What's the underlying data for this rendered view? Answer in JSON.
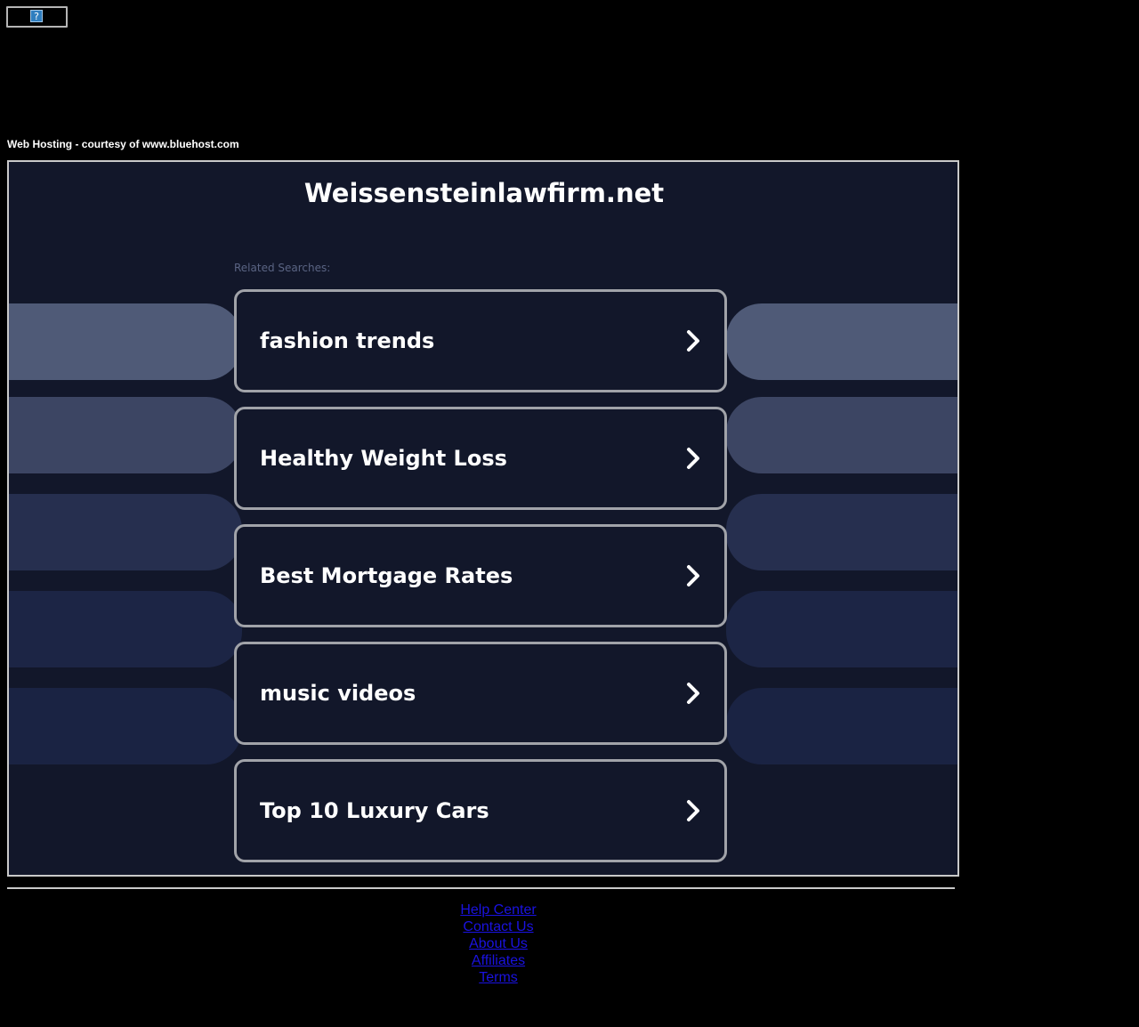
{
  "header": {
    "broken_image_icon": "question-mark-icon",
    "broken_image_glyph": "?",
    "courtesy_text": "Web Hosting - courtesy of www.bluehost.com"
  },
  "main": {
    "site_title": "Weissensteinlawfirm.net",
    "related_label": "Related Searches:",
    "searches": [
      {
        "label": "fashion trends",
        "icon": "chevron-right-icon"
      },
      {
        "label": "Healthy Weight Loss",
        "icon": "chevron-right-icon"
      },
      {
        "label": "Best Mortgage Rates",
        "icon": "chevron-right-icon"
      },
      {
        "label": "music videos",
        "icon": "chevron-right-icon"
      },
      {
        "label": "Top 10 Luxury Cars",
        "icon": "chevron-right-icon"
      }
    ],
    "band_colors": [
      "#4f5a77",
      "#3c4563",
      "#262f4f",
      "#1c2545",
      "#1a2343"
    ],
    "background_color": "#12172a",
    "card_border_color": "#a1a3a9"
  },
  "footer": {
    "links": [
      "Help Center",
      "Contact Us",
      "About Us",
      "Affiliates",
      "Terms"
    ],
    "link_color": "#1a12e0"
  }
}
